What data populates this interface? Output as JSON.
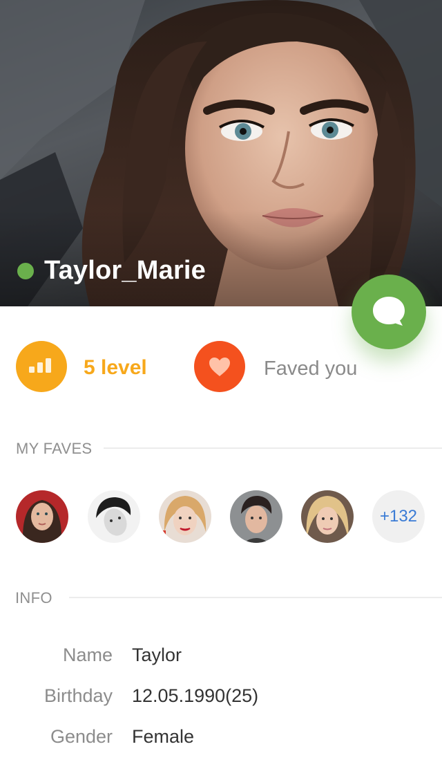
{
  "profile": {
    "username": "Taylor_Marie",
    "online_status": "online",
    "photo_icon": "profile-photo"
  },
  "actions": {
    "chat_icon": "chat-bubble-icon"
  },
  "stats": {
    "level_label": "5 level",
    "level_icon": "signal-bars-icon",
    "faved_label": "Faved you",
    "faved_icon": "heart-icon"
  },
  "faves": {
    "title": "MY FAVES",
    "avatars": [
      "avatar-1",
      "avatar-2",
      "avatar-3",
      "avatar-4",
      "avatar-5"
    ],
    "more_count": "+132"
  },
  "info": {
    "title": "INFO",
    "rows": [
      {
        "label": "Name",
        "value": "Taylor"
      },
      {
        "label": "Birthday",
        "value": "12.05.1990(25)"
      },
      {
        "label": "Gender",
        "value": "Female"
      }
    ]
  },
  "colors": {
    "accent_green": "#6ab04c",
    "level_orange": "#f7a81b",
    "fave_red": "#f4511e",
    "link_blue": "#3a7bd5"
  }
}
